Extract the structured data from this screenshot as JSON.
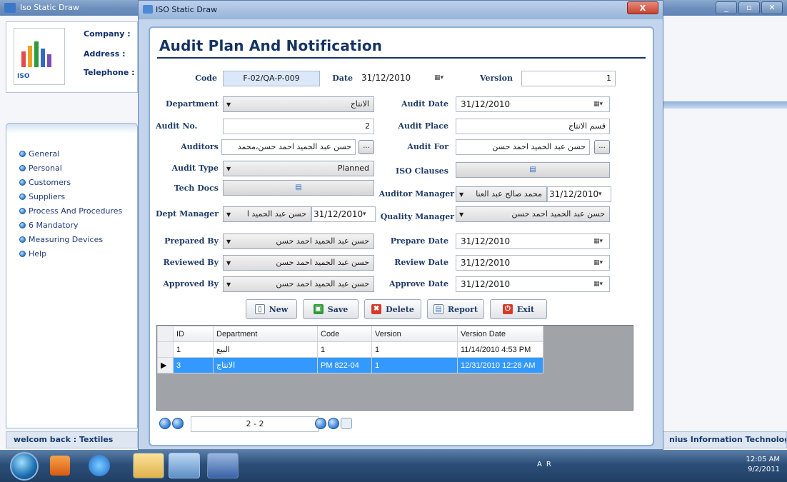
{
  "background_window": {
    "title": "Iso Static Draw",
    "company_labels": [
      "Company :",
      "Address :",
      "Telephone :"
    ],
    "logo_text": "ISO",
    "nav_items": [
      "General",
      "Personal",
      "Customers",
      "Suppliers",
      "Process And Procedures",
      "6 Mandatory",
      "Measuring Devices",
      "Help"
    ],
    "status_left": "welcom back : Textiles",
    "status_right": "nius Information Technology"
  },
  "dialog": {
    "title": "ISO Static Draw",
    "close_label": "X",
    "heading": "Audit Plan And Notification",
    "labels": {
      "code": "Code",
      "date": "Date",
      "version": "Version",
      "department": "Department",
      "audit_date": "Audit Date",
      "audit_no": "Audit No.",
      "audit_place": "Audit Place",
      "auditors": "Auditors",
      "audit_for": "Audit For",
      "audit_type": "Audit Type",
      "iso_clauses": "ISO Clauses",
      "tech_docs": "Tech Docs",
      "auditor_manager": "Auditor Manager",
      "dept_manager": "Dept Manager",
      "quality_manager": "Quality Manager",
      "prepared_by": "Prepared By",
      "prepare_date": "Prepare Date",
      "reviewed_by": "Reviewed By",
      "review_date": "Review Date",
      "approved_by": "Approved By",
      "approve_date": "Approve Date"
    },
    "values": {
      "code": "F-02/QA-P-009",
      "date": "31/12/2010",
      "version": "1",
      "department": "الانتاج",
      "audit_date": "31/12/2010",
      "audit_no": "2",
      "audit_place": "قسم الانتاج",
      "auditors": "حسن عبد الحميد احمد حسن،محمد",
      "audit_for": "حسن عبد الحميد احمد حسن",
      "audit_type": "Planned",
      "auditor_manager": "محمد صالح عبد العنا",
      "auditor_manager_date": "31/12/2010",
      "dept_manager": "حسن عبد الحميد ا",
      "dept_manager_date": "31/12/2010",
      "quality_manager": "حسن عبد الحميد احمد حسن",
      "prepared_by": "حسن عبد الحميد احمد حسن",
      "prepare_date": "31/12/2010",
      "reviewed_by": "حسن عبد الحميد احمد حسن",
      "review_date": "31/12/2010",
      "approved_by": "حسن عبد الحميد احمد حسن",
      "approve_date": "31/12/2010"
    },
    "buttons": {
      "new": "New",
      "save": "Save",
      "delete": "Delete",
      "report": "Report",
      "exit": "Exit",
      "ellipsis": "..."
    },
    "grid": {
      "columns": [
        "ID",
        "Department",
        "Code",
        "Version",
        "Version Date"
      ],
      "rows": [
        {
          "id": "1",
          "department": "البيع",
          "code": "1",
          "version": "1",
          "version_date": "11/14/2010 4:53 PM"
        },
        {
          "id": "3",
          "department": "الانتاج",
          "code": "PM 822-04",
          "version": "1",
          "version_date": "12/31/2010 12:28 AM"
        }
      ],
      "selected_row": 1
    },
    "pager": "2 - 2"
  },
  "taskbar": {
    "tray_lang": "AR",
    "time": "12:05 AM",
    "date": "9/2/2011"
  },
  "colors": {
    "heading": "#153463",
    "selection": "#3399ff",
    "label": "#1f3b66"
  }
}
